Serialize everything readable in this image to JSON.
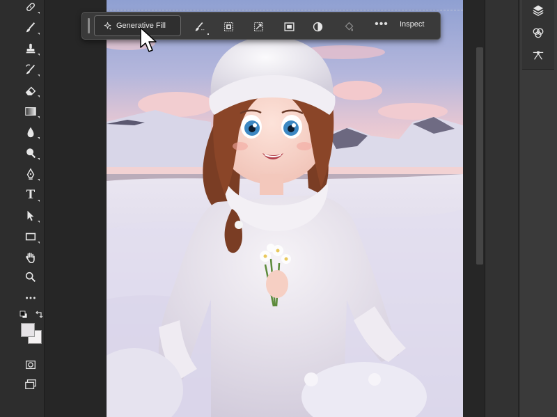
{
  "taskbar": {
    "generate_label": "Generative Fill",
    "inspect_label": "Inspect",
    "more_label": "•••"
  },
  "tools": [
    "healing-brush",
    "brush",
    "clone-stamp",
    "history-brush",
    "eraser",
    "gradient",
    "blur",
    "dodge",
    "pen",
    "type",
    "path-selection",
    "rectangle",
    "hand",
    "zoom",
    "edit-toolbar"
  ],
  "type_tool_glyph": "T",
  "colors": {
    "foreground": "#e6e3e6",
    "background": "#f4f1f2",
    "panel": "#2d2d2d",
    "taskbar": "#3a3a3a"
  },
  "canvas": {
    "subject": "cartoon girl in white knit hat and sweater holding small white flowers in snowy landscape"
  }
}
